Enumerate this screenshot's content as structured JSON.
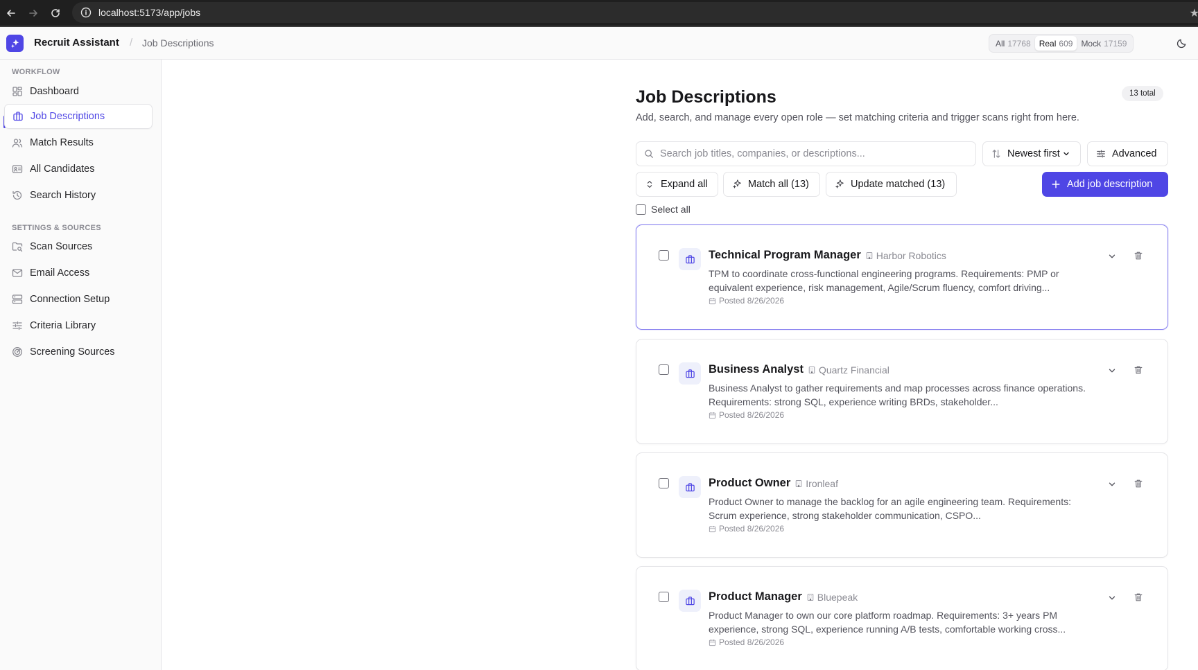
{
  "browser": {
    "url": "localhost:5173/app/jobs"
  },
  "header": {
    "app_name": "Recruit Assistant",
    "breadcrumb_sep": "/",
    "breadcrumb": "Job Descriptions",
    "filters": [
      {
        "label": "All",
        "count": "17768",
        "active": false
      },
      {
        "label": "Real",
        "count": "609",
        "active": true
      },
      {
        "label": "Mock",
        "count": "17159",
        "active": false
      }
    ]
  },
  "sidebar": {
    "workflow_heading": "WORKFLOW",
    "workflow_items": [
      {
        "label": "Dashboard",
        "icon": "dashboard-icon"
      },
      {
        "label": "Job Descriptions",
        "icon": "briefcase-icon",
        "active": true
      },
      {
        "label": "Match Results",
        "icon": "users-icon"
      },
      {
        "label": "All Candidates",
        "icon": "id-card-icon"
      },
      {
        "label": "Search History",
        "icon": "history-icon"
      }
    ],
    "settings_heading": "SETTINGS & SOURCES",
    "settings_items": [
      {
        "label": "Scan Sources",
        "icon": "folder-search-icon"
      },
      {
        "label": "Email Access",
        "icon": "mail-icon"
      },
      {
        "label": "Connection Setup",
        "icon": "server-icon"
      },
      {
        "label": "Criteria Library",
        "icon": "sliders-icon"
      },
      {
        "label": "Screening Sources",
        "icon": "radar-icon"
      }
    ]
  },
  "main": {
    "title": "Job Descriptions",
    "subtitle": "Add, search, and manage every open role — set matching criteria and trigger scans right from here.",
    "total_badge": "13 total",
    "search_placeholder": "Search job titles, companies, or descriptions...",
    "sort_label": "Newest first",
    "advanced_label": "Advanced",
    "expand_all_label": "Expand all",
    "match_all_label": "Match all (13)",
    "update_matched_label": "Update matched (13)",
    "add_label": "Add job description",
    "select_all_label": "Select all"
  },
  "jobs": [
    {
      "title": "Technical Program Manager",
      "company": "Harbor Robotics",
      "description": "TPM to coordinate cross-functional engineering programs. Requirements: PMP or equivalent experience, risk management, Agile/Scrum fluency, comfort driving...",
      "posted": "Posted 8/26/2026",
      "selected": true
    },
    {
      "title": "Business Analyst",
      "company": "Quartz Financial",
      "description": "Business Analyst to gather requirements and map processes across finance operations. Requirements: strong SQL, experience writing BRDs, stakeholder...",
      "posted": "Posted 8/26/2026",
      "selected": false
    },
    {
      "title": "Product Owner",
      "company": "Ironleaf",
      "description": "Product Owner to manage the backlog for an agile engineering team. Requirements: Scrum experience, strong stakeholder communication, CSPO...",
      "posted": "Posted 8/26/2026",
      "selected": false
    },
    {
      "title": "Product Manager",
      "company": "Bluepeak",
      "description": "Product Manager to own our core platform roadmap. Requirements: 3+ years PM experience, strong SQL, experience running A/B tests, comfortable working cross...",
      "posted": "Posted 8/26/2026",
      "selected": false
    }
  ],
  "colors": {
    "accent": "#4f46e5",
    "sidebar_bg": "#fafafa",
    "border": "#e4e4e7"
  }
}
